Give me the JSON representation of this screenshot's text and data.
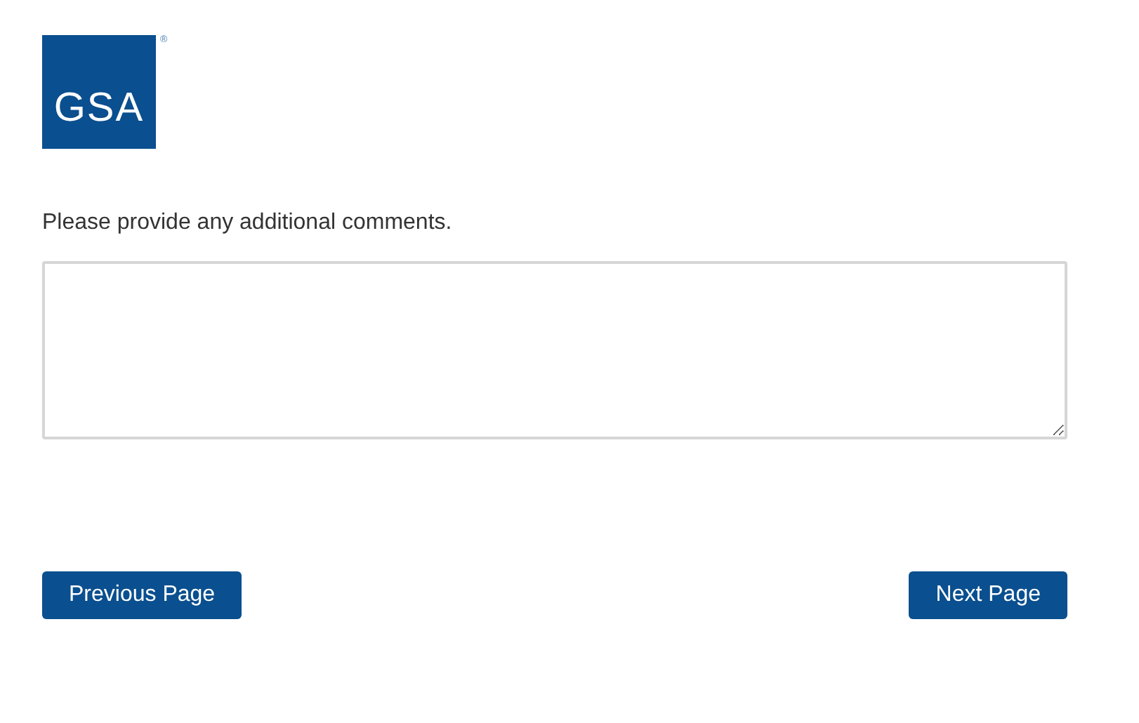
{
  "logo": {
    "text": "GSA",
    "mark": "®"
  },
  "question": {
    "label": "Please provide any additional comments."
  },
  "buttons": [
    {
      "label": "Previous Page"
    },
    {
      "label": "Next Page"
    }
  ]
}
